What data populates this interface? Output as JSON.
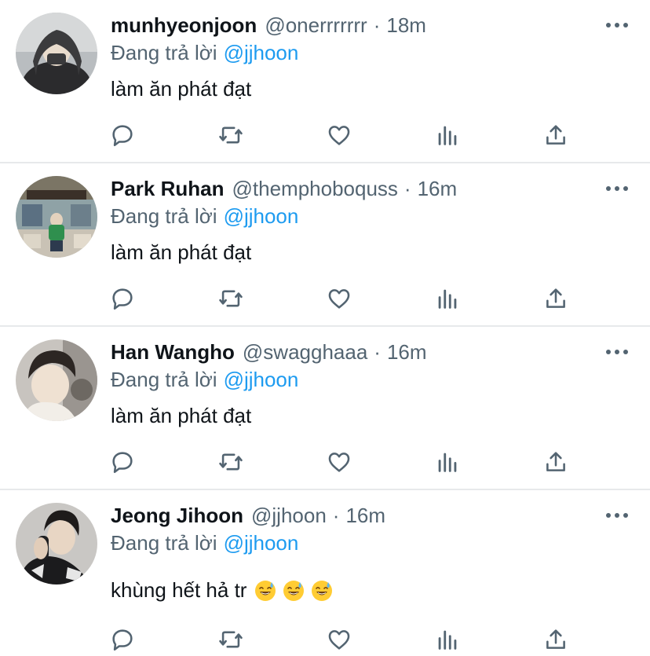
{
  "reply_prefix": "Đang trả lời",
  "colors": {
    "text": "#0f1419",
    "secondary": "#536471",
    "link": "#1d9bf0",
    "divider": "#e7e9eb"
  },
  "icons": [
    "reply-icon",
    "retweet-icon",
    "like-icon",
    "analytics-icon",
    "share-icon",
    "more-icon"
  ],
  "tweets": [
    {
      "name": "munhyeonjoon",
      "handle": "@onerrrrrrr",
      "time": "18m",
      "reply_to": "@jjhoon",
      "text": "làm ăn phát đạt",
      "emoji": []
    },
    {
      "name": "Park Ruhan",
      "handle": "@themphoboquss",
      "time": "16m",
      "reply_to": "@jjhoon",
      "text": "làm ăn phát đạt",
      "emoji": []
    },
    {
      "name": "Han Wangho",
      "handle": "@swagghaaa",
      "time": "16m",
      "reply_to": "@jjhoon",
      "text": "làm ăn phát đạt",
      "emoji": []
    },
    {
      "name": "Jeong Jihoon",
      "handle": "@jjhoon",
      "time": "16m",
      "reply_to": "@jjhoon",
      "text": "khùng hết hả tr",
      "emoji": [
        "grinning-sweat-emoji",
        "grinning-sweat-emoji",
        "grinning-sweat-emoji"
      ]
    }
  ]
}
